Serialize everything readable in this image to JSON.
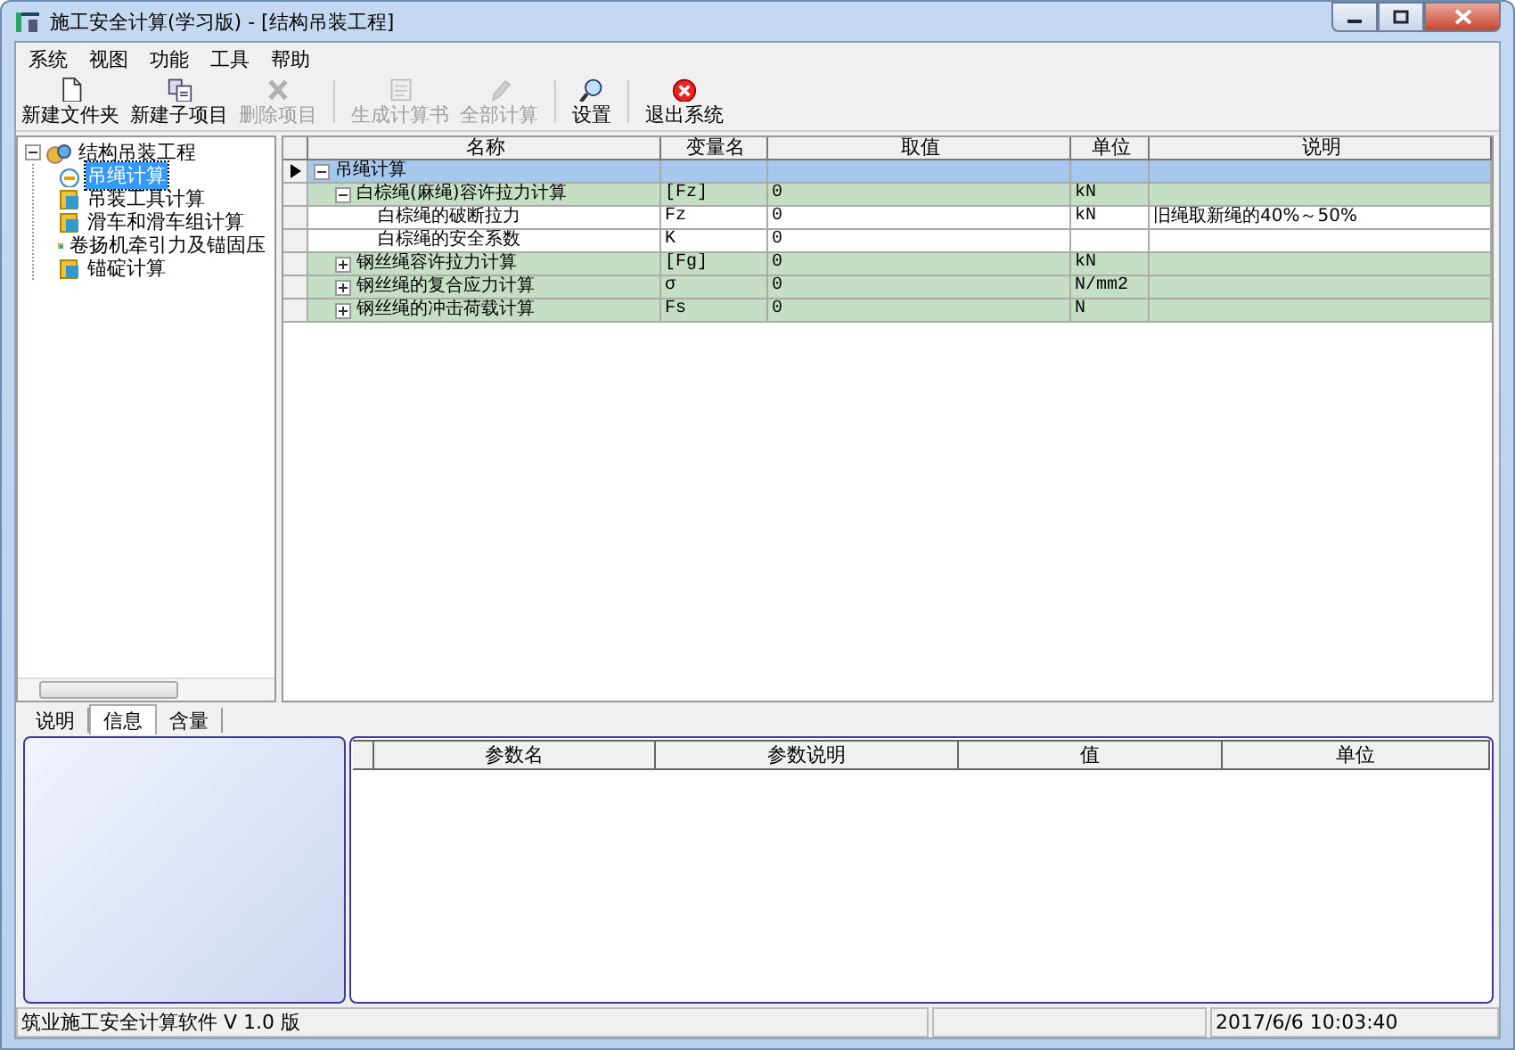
{
  "window": {
    "title": "施工安全计算(学习版) - [结构吊装工程]"
  },
  "menu": [
    "系统",
    "视图",
    "功能",
    "工具",
    "帮助"
  ],
  "toolbar": [
    {
      "kind": "new-folder",
      "label": "新建文件夹",
      "disabled": false
    },
    {
      "kind": "new-item",
      "label": "新建子项目",
      "disabled": false
    },
    {
      "kind": "delete",
      "label": "删除项目",
      "disabled": true
    },
    {
      "kind": "report",
      "label": "生成计算书",
      "disabled": true
    },
    {
      "kind": "calc",
      "label": "全部计算",
      "disabled": true
    },
    {
      "kind": "settings",
      "label": "设置",
      "disabled": false
    },
    {
      "kind": "exit",
      "label": "退出系统",
      "disabled": false
    }
  ],
  "tree": {
    "label": "结构吊装工程",
    "expanded": true,
    "children": [
      {
        "label": "吊绳计算",
        "selected": true
      },
      {
        "label": "吊装工具计算",
        "selected": false
      },
      {
        "label": "滑车和滑车组计算",
        "selected": false
      },
      {
        "label": "卷扬机牵引力及锚固压",
        "selected": false
      },
      {
        "label": "锚碇计算",
        "selected": false
      }
    ]
  },
  "grid": {
    "columns": [
      "名称",
      "变量名",
      "取值",
      "单位",
      "说明"
    ],
    "rows": [
      {
        "kind": "category",
        "name": "吊绳计算",
        "current": true,
        "expanded": true,
        "children": [
          {
            "kind": "group",
            "name": "白棕绳(麻绳)容许拉力计算",
            "variable": "[Fz]",
            "value": "0",
            "unit": "kN",
            "expanded": true,
            "children": [
              {
                "kind": "item",
                "name": "白棕绳的破断拉力",
                "variable": "Fz",
                "value": "0",
                "unit": "kN",
                "note": "旧绳取新绳的40%～50%"
              },
              {
                "kind": "item",
                "name": "白棕绳的安全系数",
                "variable": "K",
                "value": "0"
              }
            ]
          },
          {
            "kind": "group",
            "name": "钢丝绳容许拉力计算",
            "variable": "[Fg]",
            "value": "0",
            "unit": "kN",
            "expanded": false
          },
          {
            "kind": "group",
            "name": "钢丝绳的复合应力计算",
            "variable": "σ",
            "value": "0",
            "unit": "N/mm2",
            "expanded": false
          },
          {
            "kind": "group",
            "name": "钢丝绳的冲击荷载计算",
            "variable": "Fs",
            "value": "0",
            "unit": "N",
            "expanded": false
          }
        ]
      }
    ]
  },
  "bottom_tabs": [
    {
      "label": "说明",
      "selected": false
    },
    {
      "label": "信息",
      "selected": true
    },
    {
      "label": "含量",
      "selected": false
    }
  ],
  "param_table": {
    "columns": [
      "参数名",
      "参数说明",
      "值",
      "单位"
    ]
  },
  "status_bar": {
    "app": "筑业施工安全计算软件 V 1.0 版",
    "datetime": "2017/6/6 10:03:40"
  }
}
